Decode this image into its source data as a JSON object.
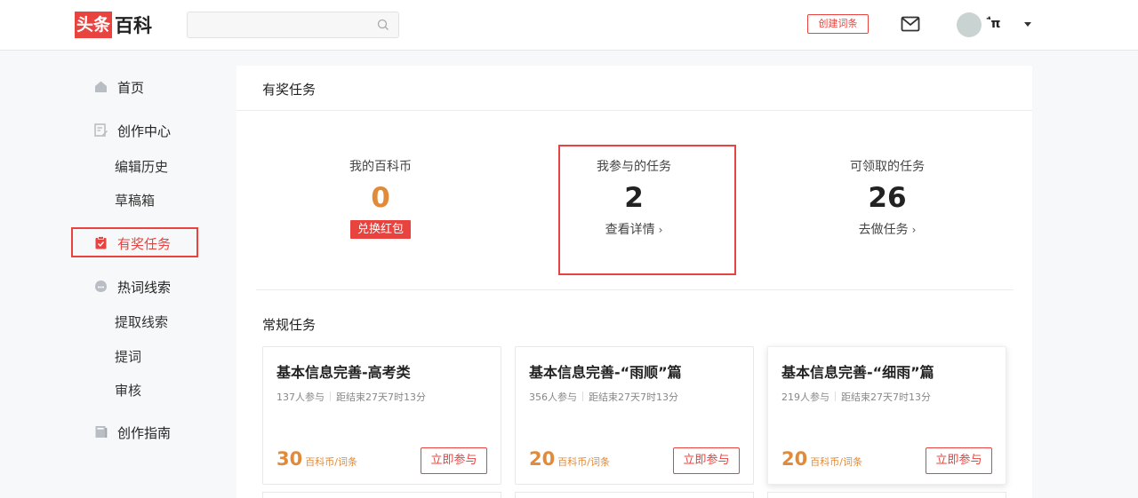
{
  "header": {
    "logo_red": "头条",
    "logo_black": "百科",
    "search": {
      "placeholder": "",
      "value": ""
    },
    "create_label": "创建词条",
    "username": "ʽ̄π"
  },
  "sidebar": {
    "items": [
      {
        "label": "首页",
        "icon": "home-icon"
      },
      {
        "label": "创作中心",
        "icon": "edit-icon"
      },
      {
        "label": "编辑历史"
      },
      {
        "label": "草稿箱"
      },
      {
        "label": "有奖任务",
        "icon": "clipboard-icon",
        "active": true
      },
      {
        "label": "热词线索",
        "icon": "bubble-icon"
      },
      {
        "label": "提取线索"
      },
      {
        "label": "提词"
      },
      {
        "label": "审核"
      },
      {
        "label": "创作指南",
        "icon": "book-icon"
      }
    ]
  },
  "main": {
    "title": "有奖任务",
    "stats": [
      {
        "label": "我的百科币",
        "value": "0",
        "action": "兑换红包"
      },
      {
        "label": "我参与的任务",
        "value": "2",
        "action": "查看详情"
      },
      {
        "label": "可领取的任务",
        "value": "26",
        "action": "去做任务"
      }
    ],
    "section_title": "常规任务",
    "tasks": [
      {
        "title": "基本信息完善-高考类",
        "participants": "137人参与",
        "deadline": "距结束27天7时13分",
        "reward": "30",
        "unit": "百科币/词条",
        "button": "立即参与"
      },
      {
        "title": "基本信息完善-“雨顺”篇",
        "participants": "356人参与",
        "deadline": "距结束27天7时13分",
        "reward": "20",
        "unit": "百科币/词条",
        "button": "立即参与"
      },
      {
        "title": "基本信息完善-“细雨”篇",
        "participants": "219人参与",
        "deadline": "距结束27天7时13分",
        "reward": "20",
        "unit": "百科币/词条",
        "button": "立即参与"
      }
    ]
  },
  "colors": {
    "brand_red": "#e8433e",
    "reward_orange": "#e08a3a"
  }
}
